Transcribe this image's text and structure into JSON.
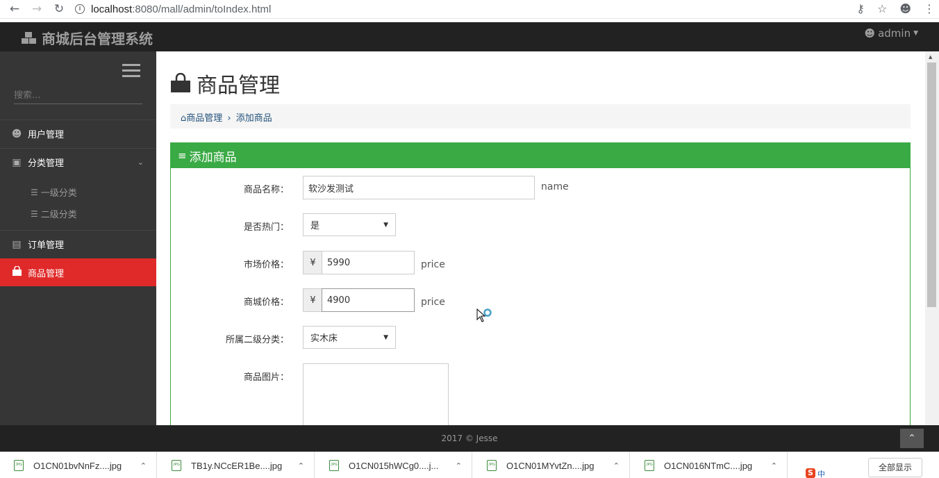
{
  "browser": {
    "url_host": "localhost",
    "url_path": ":8080/mall/admin/toIndex.html"
  },
  "topbar": {
    "brand": "商城后台管理系统",
    "user": "admin"
  },
  "sidebar": {
    "search_placeholder": "搜索...",
    "items": [
      {
        "label": "用户管理",
        "icon": "user-circle-icon"
      },
      {
        "label": "分类管理",
        "icon": "category-icon"
      },
      {
        "label": "一级分类",
        "icon": "list-icon"
      },
      {
        "label": "二级分类",
        "icon": "list-icon"
      },
      {
        "label": "订单管理",
        "icon": "file-icon"
      },
      {
        "label": "商品管理",
        "icon": "shopping-bag-icon",
        "active": true
      }
    ]
  },
  "main": {
    "title": "商品管理",
    "breadcrumb": {
      "home": "商品管理",
      "current": "添加商品"
    },
    "panel_title": "添加商品",
    "form": {
      "name_label": "商品名称：",
      "name_value": "软沙发测试",
      "name_hint": "name",
      "hot_label": "是否热门：",
      "hot_value": "是",
      "market_price_label": "市场价格：",
      "market_price_value": "5990",
      "market_price_hint": "price",
      "mall_price_label": "商城价格：",
      "mall_price_value": "4900",
      "mall_price_hint": "price",
      "currency": "¥",
      "category_label": "所属二级分类：",
      "category_value": "实木床",
      "image_label": "商品图片："
    }
  },
  "footer": {
    "text": "2017 © Jesse"
  },
  "downloads": {
    "items": [
      "O1CN01bvNnFz....jpg",
      "TB1y.NCcER1Be....jpg",
      "O1CN015hWCg0....j...",
      "O1CN01MYvtZn....jpg",
      "O1CN016NTmC....jpg"
    ],
    "show_all": "全部显示"
  },
  "colors": {
    "accent_active": "#e02a2a",
    "panel_green": "#3aaa44",
    "sidebar_bg": "#363636",
    "topbar_bg": "#222222"
  }
}
